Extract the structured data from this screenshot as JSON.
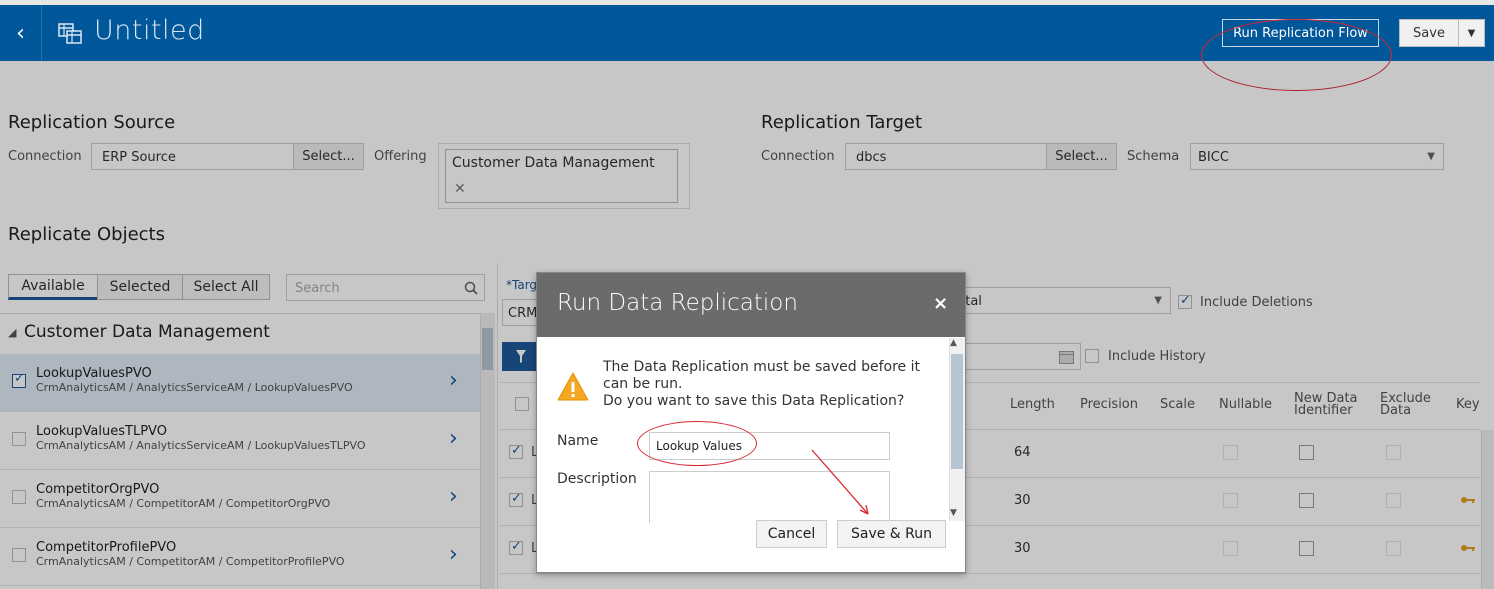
{
  "header": {
    "title": "Untitled",
    "run_flow_label": "Run Replication Flow",
    "save_label": "Save"
  },
  "source": {
    "heading": "Replication Source",
    "connection_label": "Connection",
    "connection_value": "ERP Source",
    "select_label": "Select...",
    "offering_label": "Offering",
    "offering_value": "Customer Data Management"
  },
  "target": {
    "heading": "Replication Target",
    "connection_label": "Connection",
    "connection_value": "dbcs",
    "select_label": "Select...",
    "schema_label": "Schema",
    "schema_value": "BICC"
  },
  "objects": {
    "heading": "Replicate Objects",
    "tabs": [
      "Available",
      "Selected",
      "Select All"
    ],
    "search_placeholder": "Search",
    "group": "Customer Data Management",
    "items": [
      {
        "name": "LookupValuesPVO",
        "path": "CrmAnalyticsAM / AnalyticsServiceAM / LookupValuesPVO",
        "checked": true
      },
      {
        "name": "LookupValuesTLPVO",
        "path": "CrmAnalyticsAM / AnalyticsServiceAM / LookupValuesTLPVO",
        "checked": false
      },
      {
        "name": "CompetitorOrgPVO",
        "path": "CrmAnalyticsAM / CompetitorAM / CompetitorOrgPVO",
        "checked": false
      },
      {
        "name": "CompetitorProfilePVO",
        "path": "CrmAnalyticsAM / CompetitorAM / CompetitorProfilePVO",
        "checked": false
      }
    ]
  },
  "detail": {
    "target_label": "*Targ",
    "target_value": "CRM_",
    "load_value": "ental",
    "include_deletions": "Include Deletions",
    "include_history": "Include History",
    "columns": [
      "Length",
      "Precision",
      "Scale",
      "Nullable",
      "New Data Identifier",
      "Exclude Data",
      "Key"
    ],
    "rows": [
      {
        "prefix": "L",
        "length": "64",
        "key": false
      },
      {
        "prefix": "L",
        "length": "30",
        "key": true
      },
      {
        "prefix": "L",
        "length": "30",
        "key": true
      }
    ]
  },
  "dialog": {
    "title": "Run Data Replication",
    "message_line1": "The Data Replication must be saved before it can be run.",
    "message_line2": "Do you want to save this Data Replication?",
    "name_label": "Name",
    "name_value": "Lookup Values",
    "description_label": "Description",
    "cancel_label": "Cancel",
    "save_run_label": "Save & Run"
  },
  "colors": {
    "header_bg": "#00579a",
    "accent": "#1d5a9a",
    "annotation": "#d8262e",
    "dialog_header": "#6b6b6b"
  }
}
